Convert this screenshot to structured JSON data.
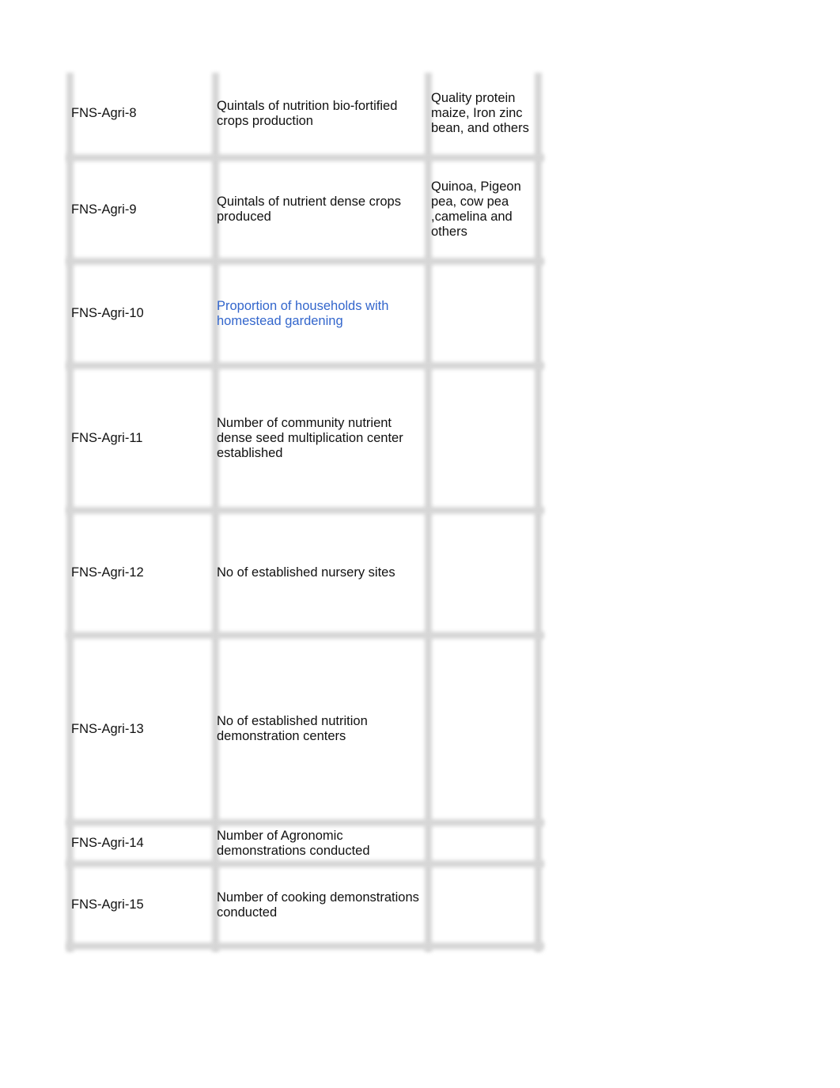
{
  "rows": [
    {
      "id": "FNS-Agri-8",
      "indicator": "Quintals of nutrition bio-fortified crops production",
      "remark": "Quality protein maize, Iron zinc bean, and others"
    },
    {
      "id": "FNS-Agri-9",
      "indicator": "Quintals of nutrient dense crops produced",
      "remark": "Quinoa, Pigeon pea, cow pea ,camelina and others"
    },
    {
      "id": "FNS-Agri-10",
      "indicator": "Proportion of households with homestead gardening",
      "remark": ""
    },
    {
      "id": "FNS-Agri-11",
      "indicator": "Number of community nutrient dense seed multiplication center established",
      "remark": ""
    },
    {
      "id": "FNS-Agri-12",
      "indicator": "No of established nursery sites",
      "remark": ""
    },
    {
      "id": "FNS-Agri-13",
      "indicator": "No of established nutrition demonstration centers",
      "remark": ""
    },
    {
      "id": "FNS-Agri-14",
      "indicator": "Number of Agronomic demonstrations conducted",
      "remark": ""
    },
    {
      "id": "FNS-Agri-15",
      "indicator": "Number of cooking demonstrations conducted",
      "remark": ""
    }
  ],
  "link_color": "#3366cc"
}
